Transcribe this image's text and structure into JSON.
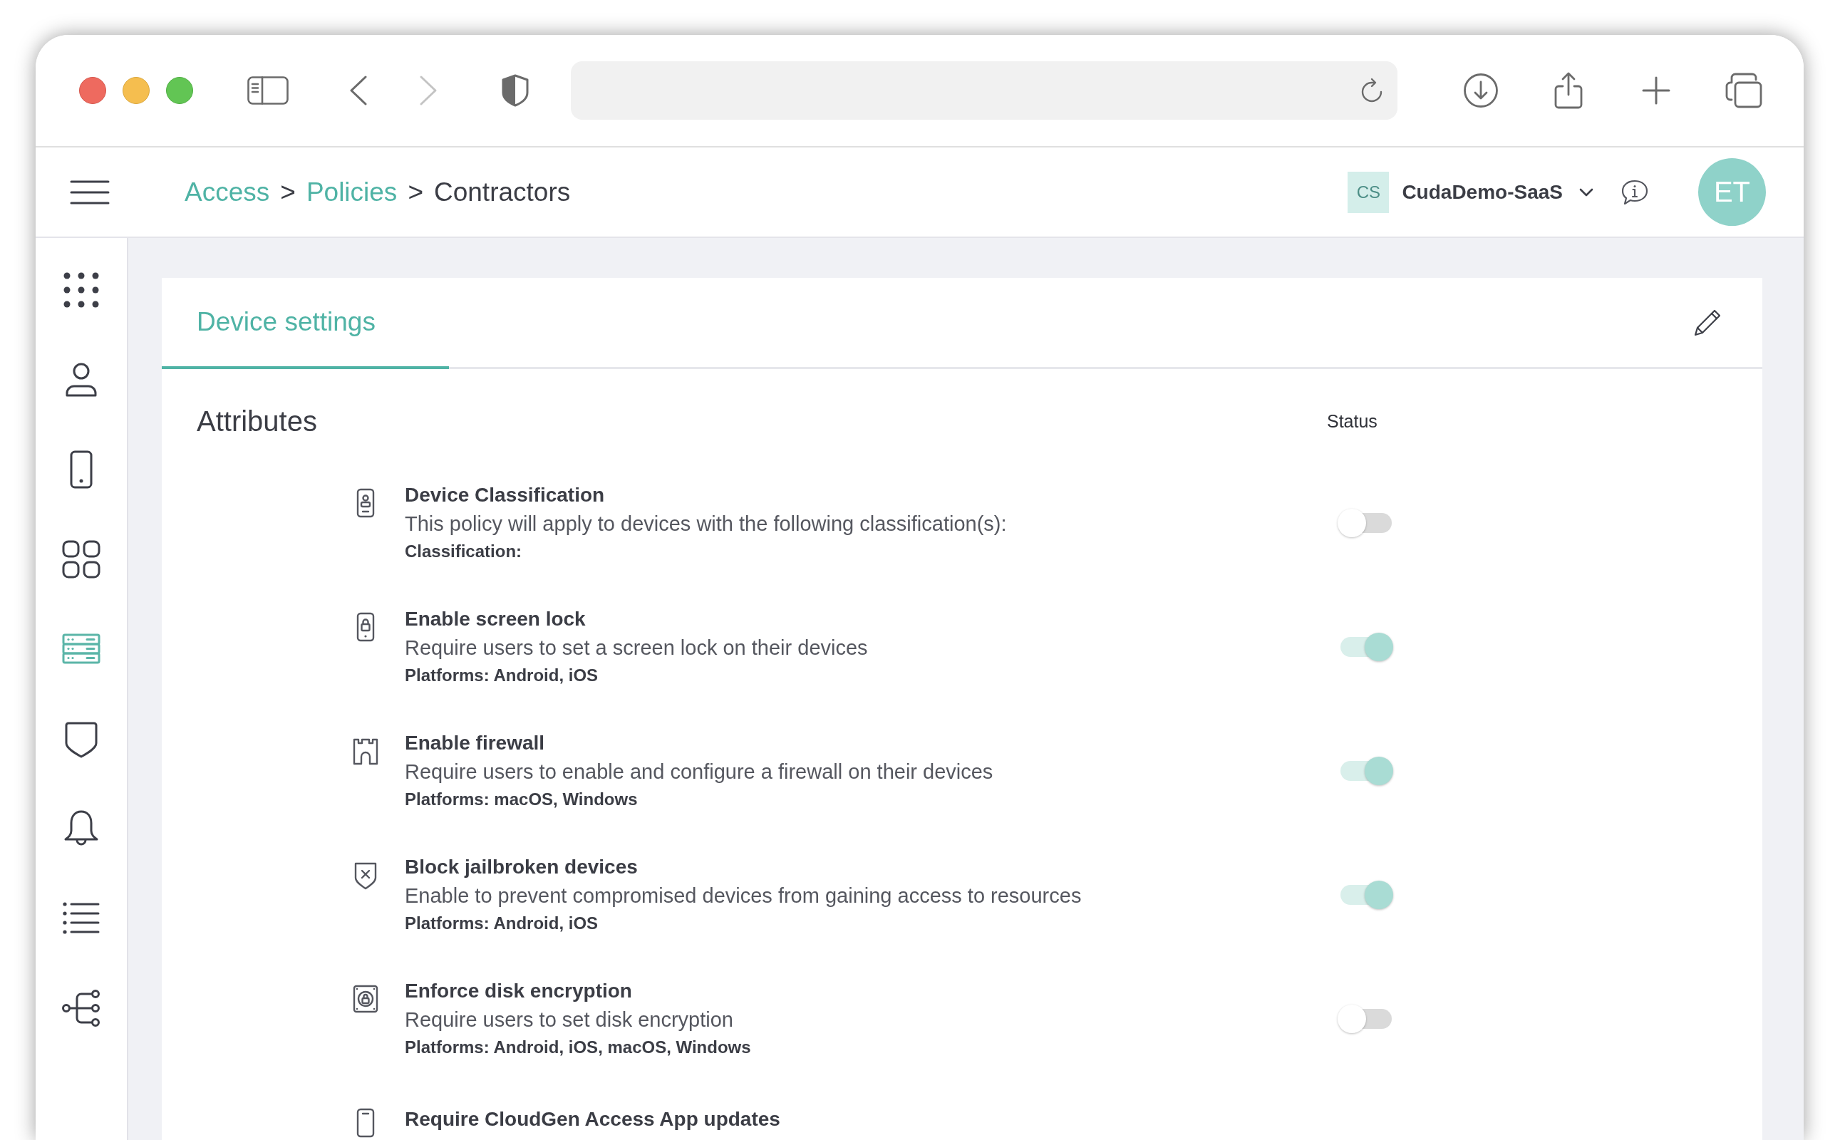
{
  "browser": {
    "back": {
      "disabled": false
    },
    "forward": {
      "disabled": true
    }
  },
  "header": {
    "breadcrumbs": [
      {
        "kind": "link",
        "label": "Access"
      },
      {
        "kind": "separator",
        "label": ">"
      },
      {
        "kind": "link",
        "label": "Policies"
      },
      {
        "kind": "separator",
        "label": ">"
      },
      {
        "kind": "current",
        "label": "Contractors"
      }
    ],
    "tenant": {
      "badge": "CS",
      "name": "CudaDemo-SaaS"
    },
    "avatar": {
      "initials": "ET"
    }
  },
  "sidebar": {
    "items": [
      {
        "kind": "apps",
        "selected": false
      },
      {
        "kind": "users",
        "selected": false
      },
      {
        "kind": "devices",
        "selected": false
      },
      {
        "kind": "applications",
        "selected": false
      },
      {
        "kind": "servers",
        "selected": true
      },
      {
        "kind": "security",
        "selected": false
      },
      {
        "kind": "alerts",
        "selected": false
      },
      {
        "kind": "logs",
        "selected": false
      },
      {
        "kind": "network",
        "selected": false
      }
    ]
  },
  "card": {
    "tabs": [
      {
        "label": "Device settings",
        "selected": true
      }
    ],
    "section": {
      "title": "Attributes",
      "status_heading": "Status"
    },
    "attributes": [
      {
        "kind": "classification",
        "title": "Device Classification",
        "description": "This policy will apply to devices with the following classification(s):",
        "detail": "Classification:",
        "on": false
      },
      {
        "kind": "screen_lock",
        "title": "Enable screen lock",
        "description": "Require users to set a screen lock on their devices",
        "detail": "Platforms: Android, iOS",
        "on": true
      },
      {
        "kind": "firewall",
        "title": "Enable firewall",
        "description": "Require users to enable and configure a firewall on their devices",
        "detail": "Platforms: macOS, Windows",
        "on": true
      },
      {
        "kind": "jailbreak",
        "title": "Block jailbroken devices",
        "description": "Enable to prevent compromised devices from gaining access to resources",
        "detail": "Platforms: Android, iOS",
        "on": true
      },
      {
        "kind": "disk",
        "title": "Enforce disk encryption",
        "description": "Require users to set disk encryption",
        "detail": "Platforms: Android, iOS, macOS, Windows",
        "on": false
      },
      {
        "kind": "app_update",
        "title": "Require CloudGen Access App updates"
      }
    ]
  }
}
